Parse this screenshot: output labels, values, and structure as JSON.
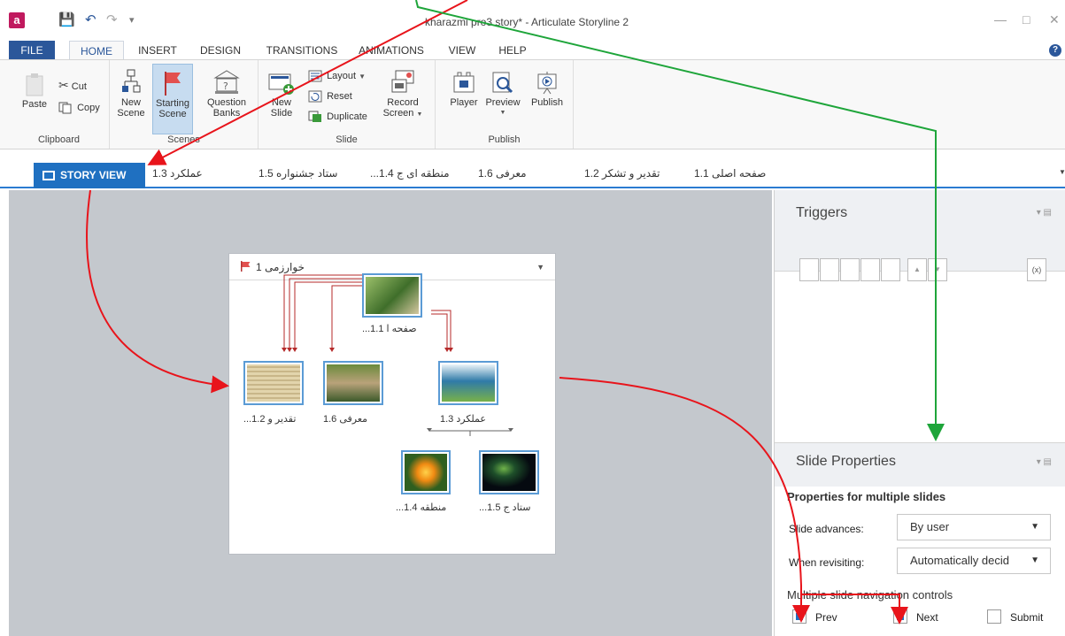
{
  "window": {
    "title": "kharazmi pro3 story* - Articulate Storyline 2",
    "help": "?"
  },
  "quick_access": {
    "save_icon": "save-icon",
    "undo_icon": "undo-icon",
    "redo_icon": "redo-icon",
    "customize_icon": "customize-icon"
  },
  "ribbon_tabs": [
    "FILE",
    "HOME",
    "INSERT",
    "DESIGN",
    "TRANSITIONS",
    "ANIMATIONS",
    "VIEW",
    "HELP"
  ],
  "ribbon": {
    "clipboard": {
      "paste": "Paste",
      "cut": "Cut",
      "copy": "Copy",
      "group": "Clipboard"
    },
    "scenes": {
      "new_scene_1": "New",
      "new_scene_2": "Scene",
      "starting_1": "Starting",
      "starting_2": "Scene",
      "qbanks_1": "Question",
      "qbanks_2": "Banks",
      "group": "Scenes"
    },
    "slide": {
      "new_slide_1": "New",
      "new_slide_2": "Slide",
      "layout": "Layout",
      "reset": "Reset",
      "duplicate": "Duplicate",
      "record_1": "Record",
      "record_2": "Screen",
      "group": "Slide"
    },
    "publish": {
      "player": "Player",
      "preview": "Preview",
      "publish": "Publish",
      "group": "Publish"
    }
  },
  "story_tabs": {
    "story_view": "STORY VIEW",
    "tabs": [
      "عملکرد 1.3",
      "ستاد جشنواره 1.5",
      "...منطقه ای ج 1.4",
      "معرفی 1.6",
      "تقدیر و تشکر 1.2",
      "صفحه اصلی 1.1"
    ]
  },
  "scene": {
    "title": "خوارزمی 1",
    "slides": [
      {
        "label": "...صفحه ا 1.1",
        "colors": [
          "#3f6e2a",
          "#9bbf6a",
          "#d5c8a0"
        ]
      },
      {
        "label": "...تقدیر و 1.2",
        "colors": [
          "#c8b689",
          "#e2d4ac",
          "#8c7a55"
        ]
      },
      {
        "label": "معرفی 1.6",
        "colors": [
          "#6b8a3c",
          "#b9a27a",
          "#3c5a2a"
        ]
      },
      {
        "label": "عملکرد 1.3",
        "colors": [
          "#2f7aa8",
          "#78b14a",
          "#eaf3f8"
        ]
      },
      {
        "label": "...منطقه 1.4",
        "colors": [
          "#2f5f1f",
          "#f08a12",
          "#ffd24a"
        ]
      },
      {
        "label": "...ستاد ج 1.5",
        "colors": [
          "#050a10",
          "#1e4f2a",
          "#6fb34a"
        ]
      }
    ]
  },
  "triggers": {
    "title": "Triggers"
  },
  "slide_properties": {
    "title": "Slide Properties",
    "subtitle": "Properties for multiple slides",
    "advances_label": "Slide advances:",
    "advances_value": "By user",
    "revisiting_label": "When revisiting:",
    "revisiting_value": "Automatically decid",
    "nav_label": "Multiple slide navigation controls",
    "prev": "Prev",
    "next": "Next",
    "submit": "Submit",
    "prev_checked": true,
    "next_checked": true,
    "submit_checked": false
  },
  "colors": {
    "accent": "#1f70c1",
    "arrow_red": "#e8141b",
    "arrow_green": "#1ea53a",
    "link_red": "#b52a2a"
  }
}
